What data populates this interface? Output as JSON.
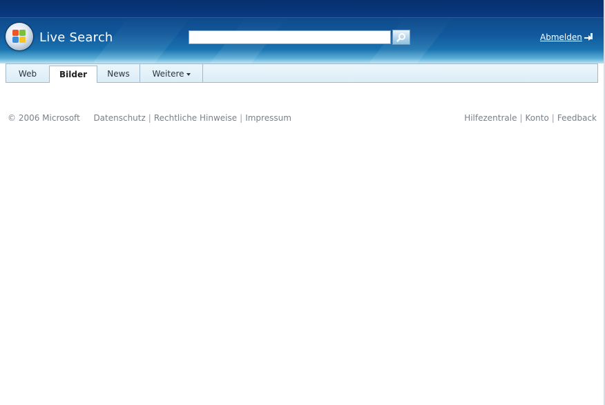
{
  "header": {
    "brand": "Live Search",
    "search": {
      "value": "",
      "placeholder": ""
    },
    "search_button_icon": "search-icon",
    "signout_label": "Abmelden",
    "signout_icon": "signout-icon",
    "colors": {
      "header_dark": "#0c3a7a",
      "header_light": "#5aaed6"
    }
  },
  "tabs": {
    "web": "Web",
    "bilder": "Bilder",
    "news": "News",
    "more": "Weitere"
  },
  "footer": {
    "copyright": "© 2006 Microsoft",
    "left_links": [
      "Datenschutz",
      "Rechtliche Hinweise",
      "Impressum"
    ],
    "right_links": [
      "Hilfezentrale",
      "Konto",
      "Feedback"
    ],
    "separator": "|"
  }
}
